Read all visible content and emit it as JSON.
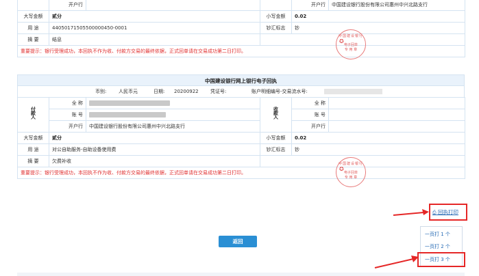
{
  "receipt1": {
    "top_left_label": "开户行",
    "top_right_label": "开户行",
    "bank_value": "中国建设银行股份有限公司惠州中兴北路支行",
    "amount_cn_label": "大写金额",
    "amount_cn_value": "贰分",
    "amount_num_label": "小写金额",
    "amount_num_value": "0.02",
    "purpose_label": "用 途",
    "purpose_value": "44050171505500000450-0001",
    "cash_label": "钞汇标志",
    "cash_value": "钞",
    "summary_label": "摘 要",
    "summary_value": "结息",
    "warning": "重要提示：银行受理成功，本回执不作为收、付款方交易的最终依据，正式回单请在交易成功第二日打印。"
  },
  "receipt2": {
    "title": "中国建设银行网上银行电子回执",
    "currency_label": "币别:",
    "currency_value": "人民币元",
    "date_label": "日期:",
    "date_value": "20200922",
    "voucher_label": "凭证号:",
    "detail_label": "账户明细编号-交易流水号:",
    "payer_label": "付款人",
    "payee_label": "收款人",
    "name_label": "全 称",
    "account_label": "账 号",
    "bank_label": "开户行",
    "payer_bank": "中国建设银行股份有限公司惠州中兴北路支行",
    "amount_cn_label": "大写金额",
    "amount_cn_value": "贰分",
    "amount_num_label": "小写金额",
    "amount_num_value": "0.02",
    "purpose_label": "用 途",
    "purpose_value": "对公自助服务-自助设备使用费",
    "cash_label": "钞汇标志",
    "cash_value": "钞",
    "summary_label": "摘 要",
    "summary_value": "欠费补收",
    "warning": "重要提示：银行受理成功，本回执不作为收、付款方交易的最终依据，正式回单请在交易成功第二日打印。"
  },
  "stamp": {
    "line1": "中国建设银行",
    "line2": "电子回单",
    "line3": "专 用 章"
  },
  "actions": {
    "print_label": "回执打印",
    "back_label": "返回",
    "options": [
      "一页打 1 个",
      "一页打 2 个",
      "一页打 3 个"
    ]
  },
  "colors": {
    "accent": "#2a8fd4",
    "highlight": "#e52626",
    "warning": "#e03030"
  }
}
